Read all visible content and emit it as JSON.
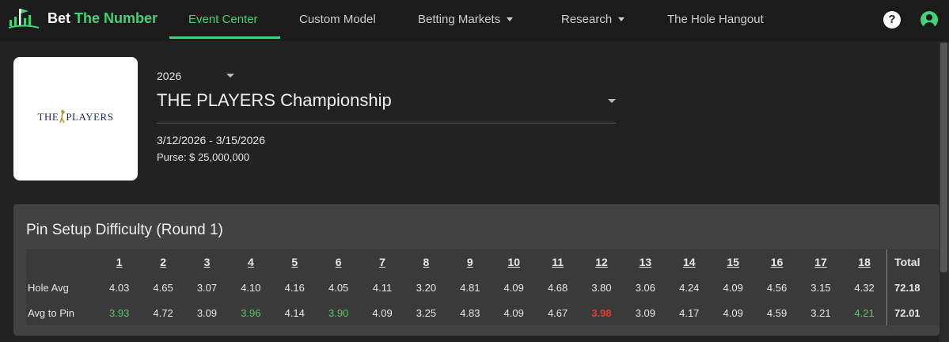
{
  "brand": {
    "name_part1": "Bet ",
    "name_part2": "The Number",
    "accent_color": "#45d07a"
  },
  "nav": {
    "items": [
      {
        "label": "Event Center",
        "active": true,
        "dropdown": false
      },
      {
        "label": "Custom Model",
        "active": false,
        "dropdown": false
      },
      {
        "label": "Betting Markets",
        "active": false,
        "dropdown": true
      },
      {
        "label": "Research",
        "active": false,
        "dropdown": true
      },
      {
        "label": "The Hole Hangout",
        "active": false,
        "dropdown": false
      }
    ],
    "help_icon": "?"
  },
  "event": {
    "logo_text_left": "THE",
    "logo_text_right": "PLAYERS",
    "year": "2026",
    "name": "THE PLAYERS Championship",
    "dates": "3/12/2026 - 3/15/2026",
    "purse": "Purse: $ 25,000,000"
  },
  "difficulty": {
    "title": "Pin Setup Difficulty (Round 1)",
    "holes": [
      "1",
      "2",
      "3",
      "4",
      "5",
      "6",
      "7",
      "8",
      "9",
      "10",
      "11",
      "12",
      "13",
      "14",
      "15",
      "16",
      "17",
      "18"
    ],
    "total_header": "Total",
    "rows": [
      {
        "label": "Hole Avg",
        "values": [
          "4.03",
          "4.65",
          "3.07",
          "4.10",
          "4.16",
          "4.05",
          "4.11",
          "3.20",
          "4.81",
          "4.09",
          "4.68",
          "3.80",
          "3.06",
          "4.24",
          "4.09",
          "4.56",
          "3.15",
          "4.32"
        ],
        "status": [
          "",
          "",
          "",
          "",
          "",
          "",
          "",
          "",
          "",
          "",
          "",
          "",
          "",
          "",
          "",
          "",
          "",
          ""
        ],
        "total": "72.18"
      },
      {
        "label": "Avg to Pin",
        "values": [
          "3.93",
          "4.72",
          "3.09",
          "3.96",
          "4.14",
          "3.90",
          "4.09",
          "3.25",
          "4.83",
          "4.09",
          "4.67",
          "3.98",
          "3.09",
          "4.17",
          "4.09",
          "4.59",
          "3.21",
          "4.21"
        ],
        "status": [
          "easy",
          "",
          "",
          "easy",
          "",
          "easy",
          "",
          "",
          "",
          "",
          "",
          "hard",
          "",
          "",
          "",
          "",
          "",
          "easy"
        ],
        "total": "72.01"
      }
    ],
    "colors": {
      "easy": "#5cc46a",
      "hard": "#e53935"
    }
  }
}
